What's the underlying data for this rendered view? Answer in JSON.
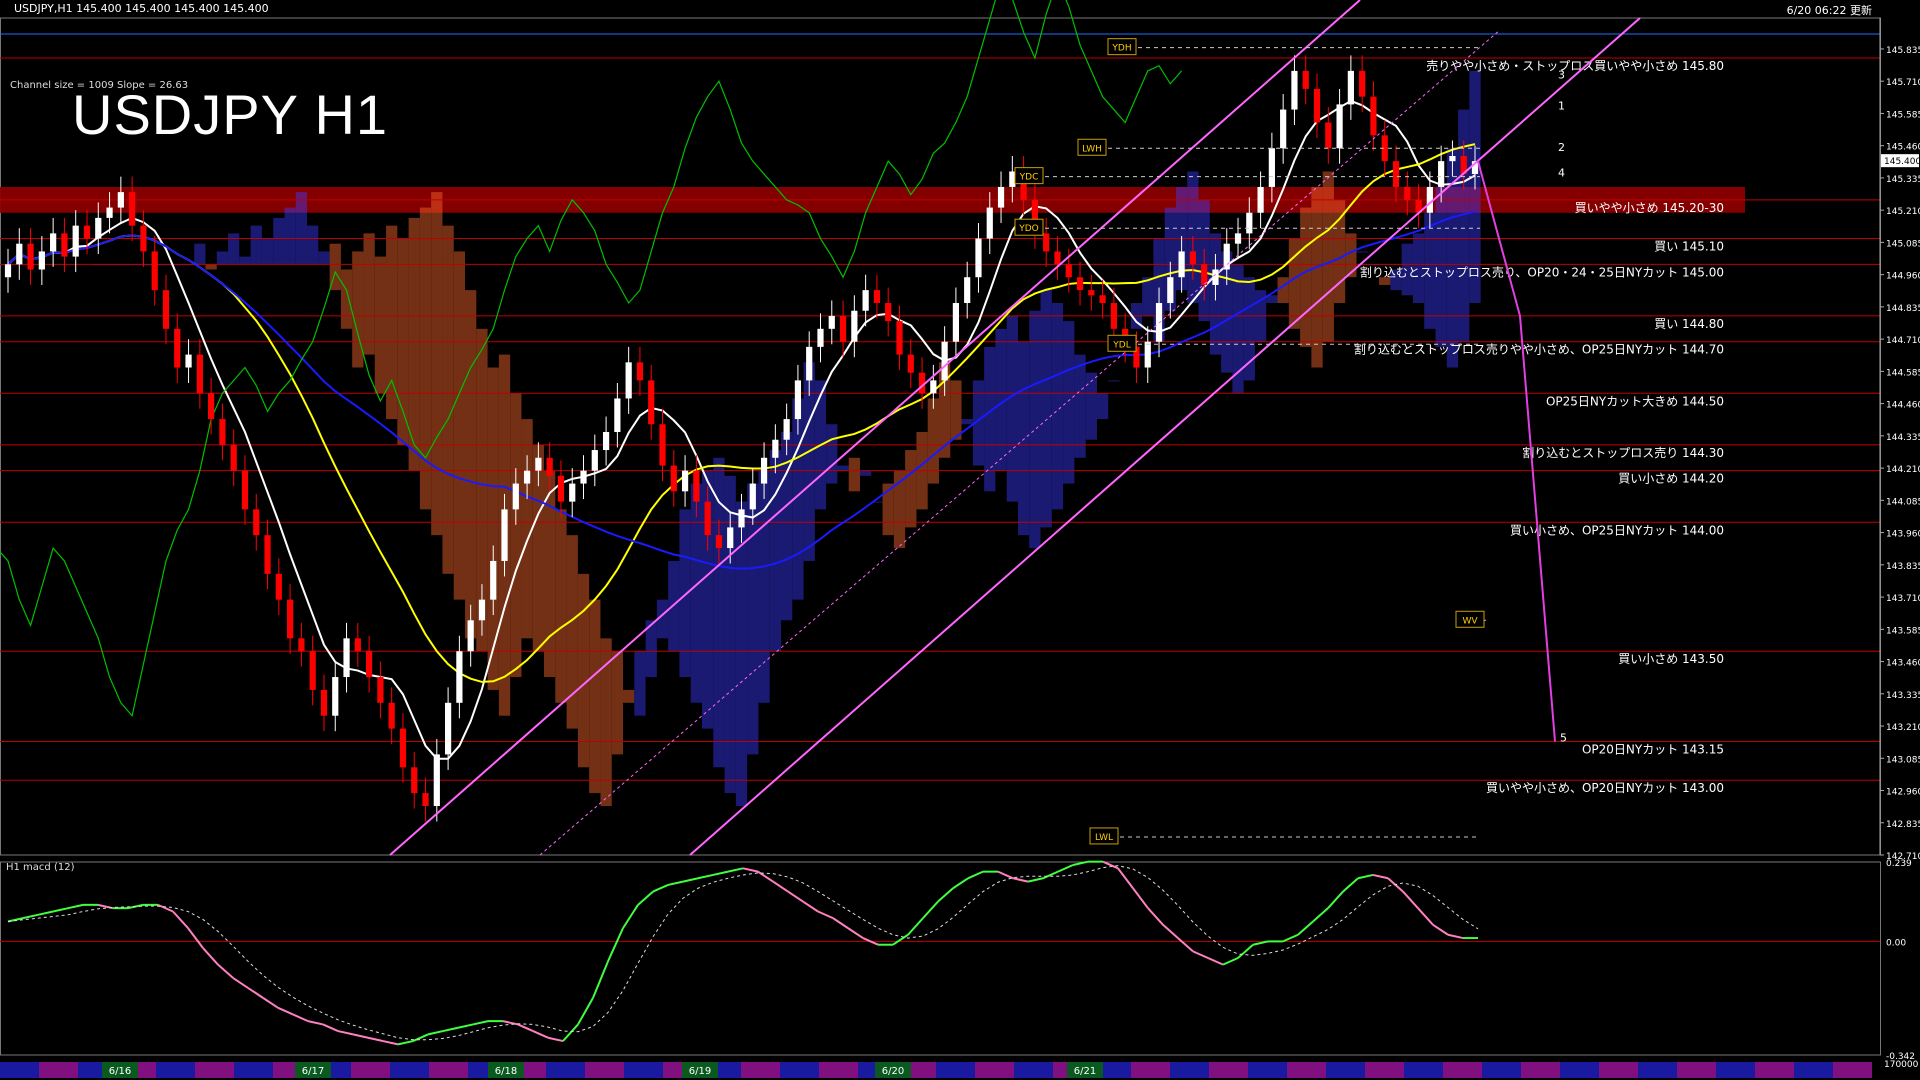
{
  "header": {
    "symbol_info": "USDJPY,H1  145.400 145.400 145.400 145.400",
    "updated": "6/20 06:22 更新"
  },
  "title": "USDJPY H1",
  "channel_info": "Channel size = 1009 Slope = 26.63",
  "macd_title": "H1  macd (12)",
  "colors": {
    "background": "#000000",
    "bull_candle": "#ffffff",
    "bear_candle": "#ff0000",
    "level_line": "#c00000",
    "resistance_zone": "#8b0000",
    "channel": "#ff66ff",
    "ma_fast": "#ffffff",
    "ma_mid": "#ffff00",
    "ma_slow": "#1a1aff",
    "chikou": "#00c000",
    "cloud_bull": "#ffffff",
    "cloud_bear": "#ff8040",
    "macd_up": "#40ff40",
    "macd_down": "#ff80c0"
  },
  "chart_data": {
    "type": "candlestick",
    "price_axis": {
      "ylim": [
        142.71,
        145.955
      ],
      "ticks": [
        "145.835",
        "145.710",
        "145.585",
        "145.460",
        "145.335",
        "145.210",
        "145.085",
        "144.960",
        "144.835",
        "144.710",
        "144.585",
        "144.460",
        "144.335",
        "144.210",
        "144.085",
        "143.960",
        "143.835",
        "143.710",
        "143.585",
        "143.460",
        "143.335",
        "143.210",
        "143.085",
        "142.960",
        "142.835",
        "142.710"
      ],
      "current_price": "145.400"
    },
    "date_labels": [
      "6/16",
      "6/17",
      "6/18",
      "6/19",
      "6/20",
      "6/21"
    ],
    "closes": [
      145.0,
      145.08,
      144.98,
      145.05,
      145.12,
      145.03,
      145.15,
      145.1,
      145.18,
      145.22,
      145.28,
      145.15,
      145.05,
      144.9,
      144.75,
      144.6,
      144.65,
      144.5,
      144.4,
      144.3,
      144.2,
      144.05,
      143.95,
      143.8,
      143.7,
      143.55,
      143.5,
      143.35,
      143.25,
      143.4,
      143.55,
      143.5,
      143.4,
      143.3,
      143.2,
      143.05,
      142.95,
      142.9,
      143.1,
      143.3,
      143.5,
      143.62,
      143.7,
      143.85,
      144.05,
      144.15,
      144.2,
      144.25,
      144.18,
      144.08,
      144.15,
      144.2,
      144.28,
      144.35,
      144.48,
      144.62,
      144.55,
      144.38,
      144.22,
      144.12,
      144.2,
      144.08,
      143.95,
      143.9,
      143.98,
      144.05,
      144.15,
      144.25,
      144.32,
      144.4,
      144.55,
      144.68,
      144.75,
      144.8,
      144.7,
      144.82,
      144.9,
      144.85,
      144.78,
      144.65,
      144.58,
      144.5,
      144.55,
      144.7,
      144.85,
      144.95,
      145.1,
      145.22,
      145.3,
      145.36,
      145.25,
      145.12,
      145.05,
      145.0,
      144.95,
      144.9,
      144.88,
      144.85,
      144.75,
      144.68,
      144.6,
      144.7,
      144.85,
      144.95,
      145.05,
      145.0,
      144.92,
      144.98,
      145.08,
      145.12,
      145.2,
      145.3,
      145.45,
      145.6,
      145.75,
      145.68,
      145.55,
      145.45,
      145.62,
      145.75,
      145.65,
      145.5,
      145.4,
      145.3,
      145.25,
      145.2,
      145.3,
      145.4,
      145.42,
      145.35,
      145.4
    ],
    "resistance_zone": [
      145.2,
      145.3
    ],
    "levels": [
      {
        "price": 145.8,
        "label": "売りやや小さめ・ストップロス買いやや小さめ 145.80"
      },
      {
        "price": 145.25,
        "label": "買いやや小さめ 145.20-30"
      },
      {
        "price": 145.1,
        "label": "買い 145.10"
      },
      {
        "price": 145.0,
        "label": "割り込むとストップロス売り、OP20・24・25日NYカット 145.00"
      },
      {
        "price": 144.8,
        "label": "買い 144.80"
      },
      {
        "price": 144.7,
        "label": "割り込むとストップロス売りやや小さめ、OP25日NYカット 144.70"
      },
      {
        "price": 144.5,
        "label": "OP25日NYカット大きめ 144.50"
      },
      {
        "price": 144.3,
        "label": "割り込むとストップロス売り 144.30"
      },
      {
        "price": 144.2,
        "label": "買い小さめ 144.20"
      },
      {
        "price": 144.0,
        "label": "買い小さめ、OP25日NYカット 144.00"
      },
      {
        "price": 143.5,
        "label": "買い小さめ 143.50"
      },
      {
        "price": 143.15,
        "label": "OP20日NYカット 143.15"
      },
      {
        "price": 143.0,
        "label": "買いやや小さめ、OP20日NYカット 143.00"
      }
    ],
    "reference_tags": [
      {
        "label": "YDH",
        "price": 145.84
      },
      {
        "label": "LWH",
        "price": 145.45
      },
      {
        "label": "YDC",
        "price": 145.34
      },
      {
        "label": "YDO",
        "price": 145.14
      },
      {
        "label": "YDL",
        "price": 144.69
      },
      {
        "label": "WV",
        "price": 143.62
      },
      {
        "label": "LWL",
        "price": 142.78
      }
    ],
    "projection_labels": [
      "3",
      "1",
      "2",
      "4",
      "5"
    ],
    "macd": {
      "ylim": [
        -0.342,
        0.239
      ],
      "ticks": [
        "0.239",
        "0.00",
        "-0.342"
      ],
      "bottom_label": "170000",
      "values": [
        0.06,
        0.07,
        0.08,
        0.09,
        0.1,
        0.11,
        0.11,
        0.1,
        0.1,
        0.11,
        0.11,
        0.09,
        0.04,
        -0.02,
        -0.07,
        -0.11,
        -0.14,
        -0.17,
        -0.2,
        -0.22,
        -0.24,
        -0.25,
        -0.27,
        -0.28,
        -0.29,
        -0.3,
        -0.31,
        -0.3,
        -0.28,
        -0.27,
        -0.26,
        -0.25,
        -0.24,
        -0.24,
        -0.25,
        -0.27,
        -0.29,
        -0.3,
        -0.25,
        -0.17,
        -0.06,
        0.04,
        0.11,
        0.15,
        0.17,
        0.18,
        0.19,
        0.2,
        0.21,
        0.22,
        0.21,
        0.18,
        0.15,
        0.12,
        0.09,
        0.07,
        0.04,
        0.01,
        -0.01,
        -0.01,
        0.02,
        0.07,
        0.12,
        0.16,
        0.19,
        0.21,
        0.21,
        0.19,
        0.18,
        0.19,
        0.21,
        0.23,
        0.24,
        0.24,
        0.22,
        0.16,
        0.1,
        0.05,
        0.01,
        -0.03,
        -0.05,
        -0.07,
        -0.05,
        -0.01,
        0.0,
        0.0,
        0.02,
        0.06,
        0.1,
        0.15,
        0.19,
        0.2,
        0.19,
        0.15,
        0.1,
        0.05,
        0.02,
        0.01,
        0.01
      ]
    }
  }
}
